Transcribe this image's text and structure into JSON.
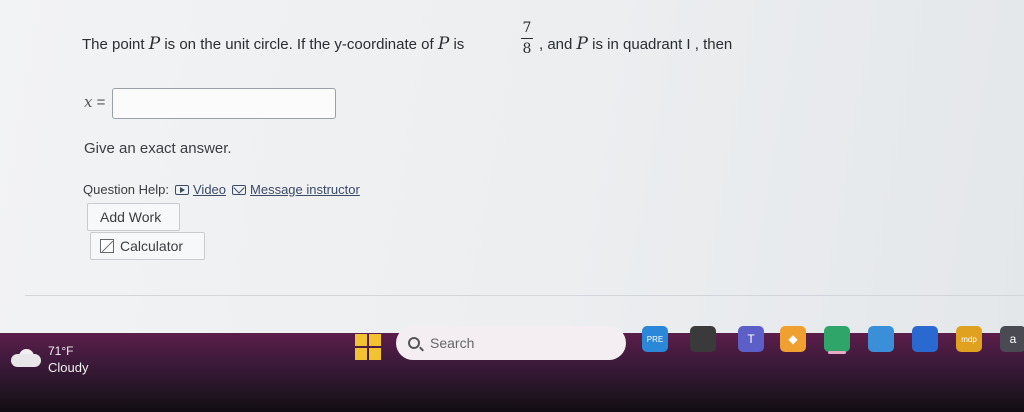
{
  "question": {
    "before_p": "The point",
    "var_p": "P",
    "mid": "is on the unit circle. If the y-coordinate of",
    "var_p2": "P",
    "is": "is",
    "frac_num": "7",
    "frac_den": "8",
    "after": ", and",
    "var_p3": "P",
    "tail": "is in quadrant I , then"
  },
  "answer": {
    "var": "x",
    "equals": "=",
    "value": ""
  },
  "hint": "Give an exact answer.",
  "help": {
    "label": "Question Help:",
    "video": "Video",
    "message": "Message instructor"
  },
  "buttons": {
    "add_work": "Add Work",
    "calculator": "Calculator"
  },
  "taskbar": {
    "temperature": "71°F",
    "condition": "Cloudy",
    "search_placeholder": "Search",
    "apps": [
      {
        "name": "widgets-app",
        "label": "PRE",
        "color": "#2b88d8"
      },
      {
        "name": "task-view-app",
        "label": "",
        "color": "#3a3a3a"
      },
      {
        "name": "teams-app",
        "label": "T",
        "color": "#5b5fc7"
      },
      {
        "name": "dropbox-app",
        "label": "◆",
        "color": "#f0a030"
      },
      {
        "name": "edge-app",
        "label": "",
        "color": "#2fa56a"
      },
      {
        "name": "file-explorer-app",
        "label": "",
        "color": "#3a8fd8"
      },
      {
        "name": "store-app",
        "label": "",
        "color": "#2a6ad0"
      },
      {
        "name": "mcafee-app",
        "label": "mdp",
        "color": "#e0a020"
      },
      {
        "name": "amazon-app",
        "label": "a",
        "color": "#4a4a52"
      }
    ]
  }
}
